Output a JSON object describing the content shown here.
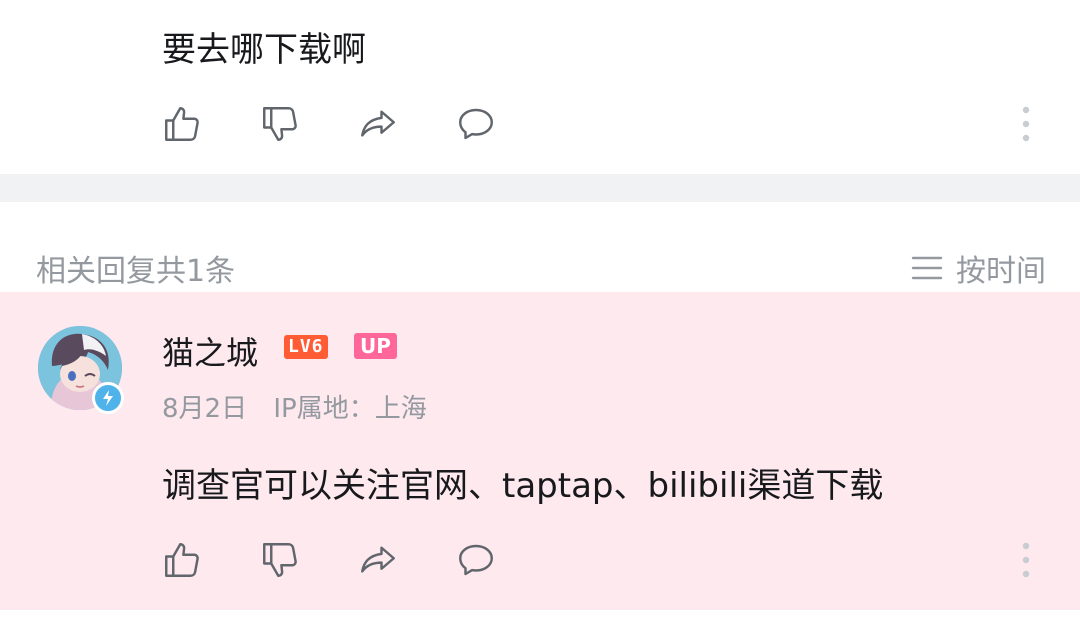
{
  "top_comment": {
    "text": "要去哪下载啊"
  },
  "replies_header": {
    "count_label": "相关回复共1条",
    "sort_label": "按时间"
  },
  "reply": {
    "username": "猫之城",
    "level_badge": "LV6",
    "up_badge": "UP",
    "date": "8月2日",
    "ip_location": "IP属地：上海",
    "text": "调查官可以关注官网、taptap、bilibili渠道下载"
  },
  "icons": {
    "like": "thumbs-up-icon",
    "dislike": "thumbs-down-icon",
    "share": "share-arrow-icon",
    "comment": "speech-bubble-icon",
    "more": "vertical-dots-icon",
    "sort": "list-lines-icon",
    "verified": "lightning-badge-icon"
  },
  "colors": {
    "reply_background": "#fde9ee",
    "level_badge": "#ff5c36",
    "up_badge": "#ff6699",
    "secondary_text": "#9499a0",
    "divider": "#f1f2f3"
  }
}
